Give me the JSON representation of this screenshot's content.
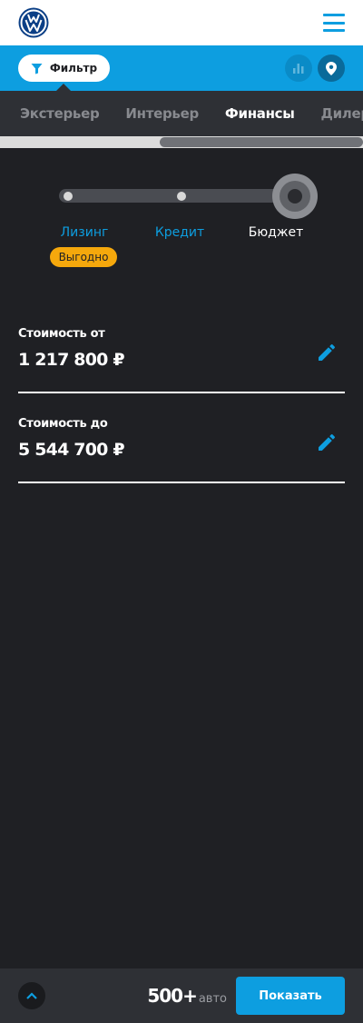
{
  "colors": {
    "accent": "#0d9ee0",
    "badge": "#f5a80c",
    "background": "#1f2024",
    "tabs_bg": "#2e3035"
  },
  "header": {
    "logo_icon": "volkswagen-logo",
    "menu_icon": "hamburger-menu-icon"
  },
  "filterbar": {
    "filter_label": "Фильтр",
    "filter_icon": "funnel-icon",
    "chart_icon": "bar-chart-icon",
    "location_icon": "location-pin-icon"
  },
  "tabs": [
    {
      "label": "Экстерьер",
      "active": false
    },
    {
      "label": "Интерьер",
      "active": false
    },
    {
      "label": "Финансы",
      "active": true
    },
    {
      "label": "Дилеры",
      "active": false
    }
  ],
  "payment_slider": {
    "options": [
      "Лизинг",
      "Кредит",
      "Бюджет"
    ],
    "selected": "Бюджет",
    "badge": "Выгодно"
  },
  "price_from": {
    "label": "Стоимость от",
    "value": "1 217 800 ₽"
  },
  "price_to": {
    "label": "Стоимость до",
    "value": "5 544 700 ₽"
  },
  "bottom": {
    "count": "500+",
    "count_unit": "авто",
    "show_label": "Показать"
  }
}
